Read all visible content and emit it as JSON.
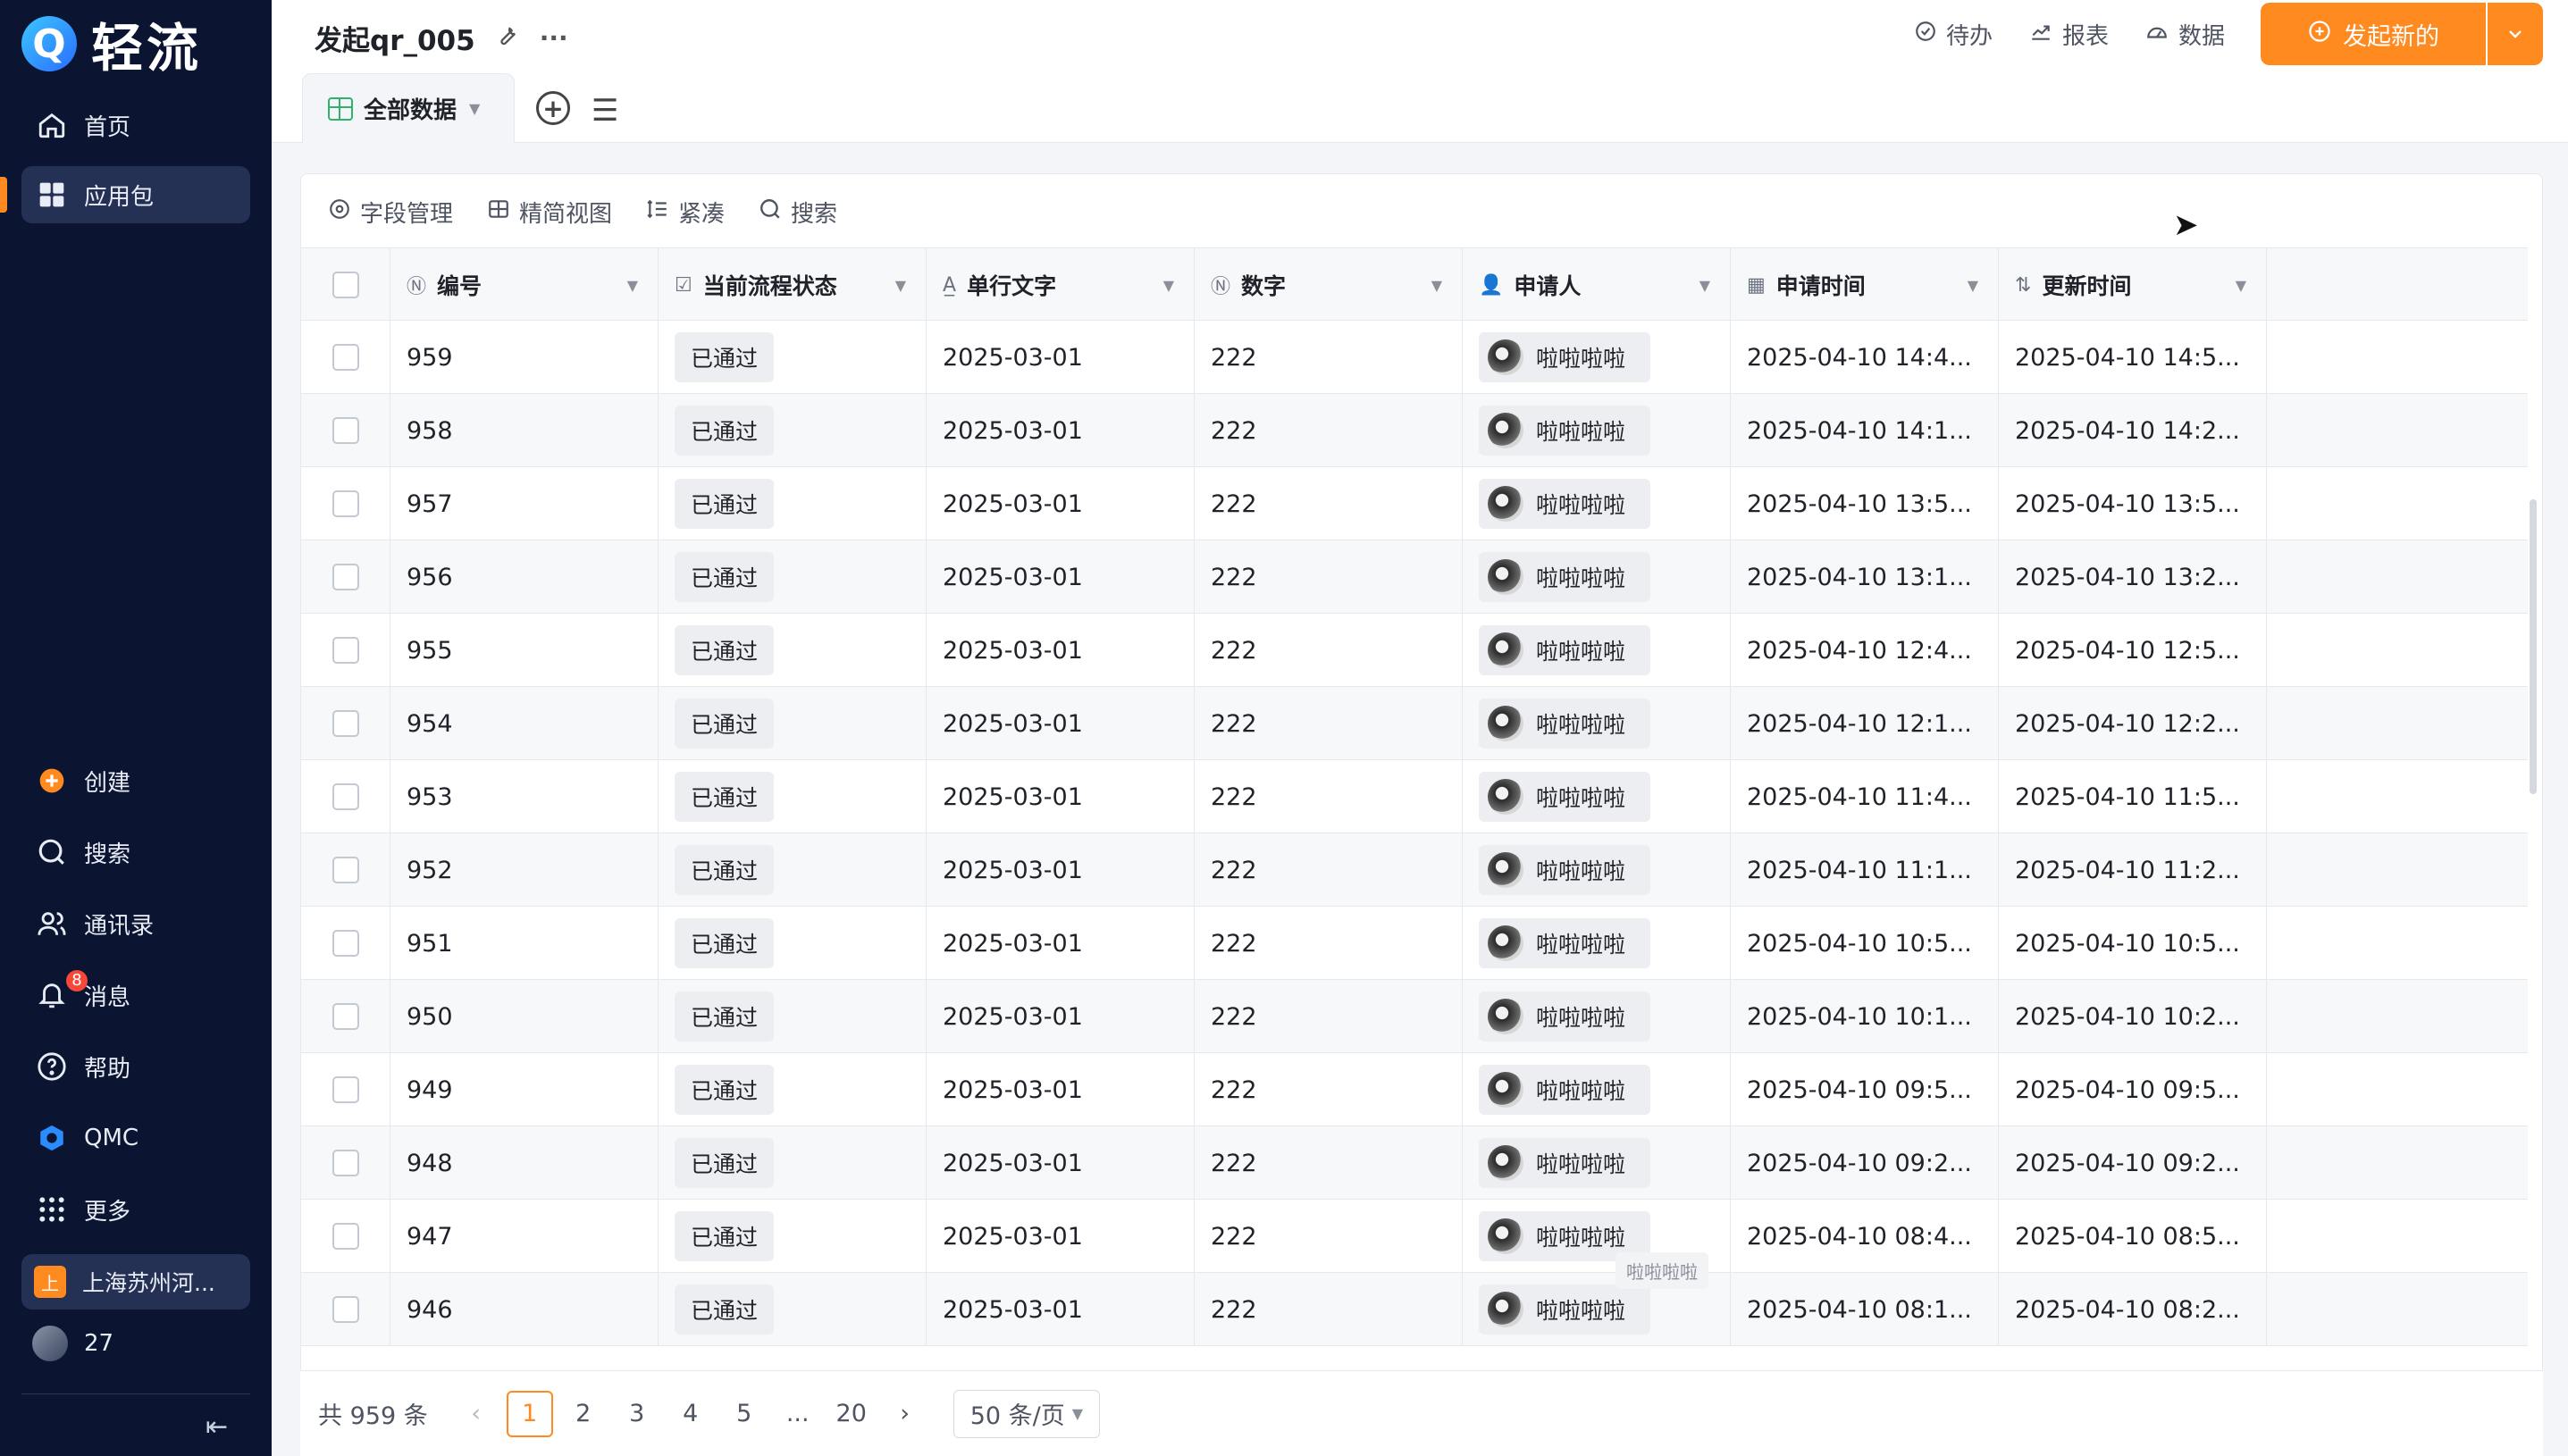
{
  "sidebar": {
    "logo_letter": "Q",
    "logo_text": "轻流",
    "top_items": [
      {
        "label": "首页",
        "icon": "home-icon"
      },
      {
        "label": "应用包",
        "icon": "apps-grid-icon"
      }
    ],
    "bottom_items": [
      {
        "label": "创建",
        "icon": "plus-circle-icon"
      },
      {
        "label": "搜索",
        "icon": "search-icon"
      },
      {
        "label": "通讯录",
        "icon": "contacts-icon"
      },
      {
        "label": "消息",
        "icon": "bell-icon"
      },
      {
        "label": "帮助",
        "icon": "help-icon"
      },
      {
        "label": "QMC",
        "icon": "qmc-icon"
      },
      {
        "label": "更多",
        "icon": "more-grid-icon"
      }
    ],
    "message_badge": "8",
    "org_icon_letter": "上",
    "org_name": "上海苏州河...",
    "user_label": "27"
  },
  "header": {
    "title": "发起qr_005",
    "active_tab": "全部数据",
    "actions": {
      "todo": "待办",
      "report": "报表",
      "data": "数据",
      "primary": "发起新的"
    }
  },
  "toolbar": {
    "fields": "字段管理",
    "simple_view": "精简视图",
    "compact": "紧凑",
    "search": "搜索"
  },
  "table": {
    "columns": [
      "编号",
      "当前流程状态",
      "单行文字",
      "数字",
      "申请人",
      "申请时间",
      "更新时间"
    ],
    "rows": [
      {
        "id": "959",
        "status": "已通过",
        "text": "2025-03-01",
        "num": "222",
        "applicant": "啦啦啦啦",
        "apply_time": "2025-04-10 14:4...",
        "update_time": "2025-04-10 14:5..."
      },
      {
        "id": "958",
        "status": "已通过",
        "text": "2025-03-01",
        "num": "222",
        "applicant": "啦啦啦啦",
        "apply_time": "2025-04-10 14:1...",
        "update_time": "2025-04-10 14:2..."
      },
      {
        "id": "957",
        "status": "已通过",
        "text": "2025-03-01",
        "num": "222",
        "applicant": "啦啦啦啦",
        "apply_time": "2025-04-10 13:5...",
        "update_time": "2025-04-10 13:5..."
      },
      {
        "id": "956",
        "status": "已通过",
        "text": "2025-03-01",
        "num": "222",
        "applicant": "啦啦啦啦",
        "apply_time": "2025-04-10 13:1...",
        "update_time": "2025-04-10 13:2..."
      },
      {
        "id": "955",
        "status": "已通过",
        "text": "2025-03-01",
        "num": "222",
        "applicant": "啦啦啦啦",
        "apply_time": "2025-04-10 12:4...",
        "update_time": "2025-04-10 12:5..."
      },
      {
        "id": "954",
        "status": "已通过",
        "text": "2025-03-01",
        "num": "222",
        "applicant": "啦啦啦啦",
        "apply_time": "2025-04-10 12:1...",
        "update_time": "2025-04-10 12:2..."
      },
      {
        "id": "953",
        "status": "已通过",
        "text": "2025-03-01",
        "num": "222",
        "applicant": "啦啦啦啦",
        "apply_time": "2025-04-10 11:4...",
        "update_time": "2025-04-10 11:5..."
      },
      {
        "id": "952",
        "status": "已通过",
        "text": "2025-03-01",
        "num": "222",
        "applicant": "啦啦啦啦",
        "apply_time": "2025-04-10 11:1...",
        "update_time": "2025-04-10 11:2..."
      },
      {
        "id": "951",
        "status": "已通过",
        "text": "2025-03-01",
        "num": "222",
        "applicant": "啦啦啦啦",
        "apply_time": "2025-04-10 10:5...",
        "update_time": "2025-04-10 10:5..."
      },
      {
        "id": "950",
        "status": "已通过",
        "text": "2025-03-01",
        "num": "222",
        "applicant": "啦啦啦啦",
        "apply_time": "2025-04-10 10:1...",
        "update_time": "2025-04-10 10:2..."
      },
      {
        "id": "949",
        "status": "已通过",
        "text": "2025-03-01",
        "num": "222",
        "applicant": "啦啦啦啦",
        "apply_time": "2025-04-10 09:5...",
        "update_time": "2025-04-10 09:5..."
      },
      {
        "id": "948",
        "status": "已通过",
        "text": "2025-03-01",
        "num": "222",
        "applicant": "啦啦啦啦",
        "apply_time": "2025-04-10 09:2...",
        "update_time": "2025-04-10 09:2..."
      },
      {
        "id": "947",
        "status": "已通过",
        "text": "2025-03-01",
        "num": "222",
        "applicant": "啦啦啦啦",
        "apply_time": "2025-04-10 08:4...",
        "update_time": "2025-04-10 08:5..."
      },
      {
        "id": "946",
        "status": "已通过",
        "text": "2025-03-01",
        "num": "222",
        "applicant": "啦啦啦啦",
        "apply_time": "2025-04-10 08:1...",
        "update_time": "2025-04-10 08:2..."
      }
    ],
    "tooltip": "啦啦啦啦"
  },
  "pagination": {
    "total": "共 959 条",
    "pages": [
      "1",
      "2",
      "3",
      "4",
      "5",
      "...",
      "20"
    ],
    "current": "1",
    "page_size": "50 条/页"
  },
  "colors": {
    "accent": "#ff8a1f",
    "sidebar_bg": "#0b1532"
  }
}
